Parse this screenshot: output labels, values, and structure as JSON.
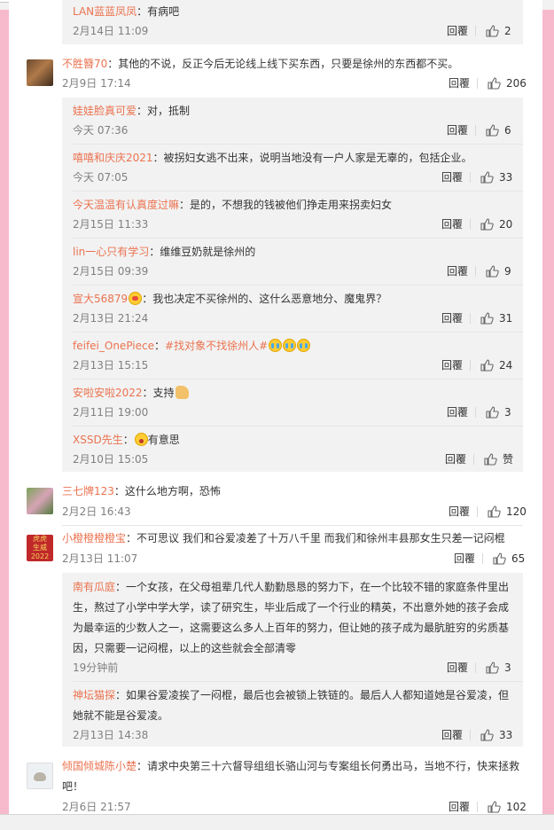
{
  "comments": [
    {
      "id": "c0",
      "user": "LAN蓝蓝凤凤",
      "text": "有病吧",
      "time": "2月14日 11:09",
      "reply": "回覆",
      "likes": "2"
    },
    {
      "id": "c1",
      "user": "不胜簪70",
      "text": "：其他的不说，反正今后无论线上线下买东西，只要是徐州的东西都不买。",
      "time": "2月9日 17:14",
      "reply": "回覆",
      "likes": "206"
    },
    {
      "id": "r1",
      "user": "娃娃脸真可爱",
      "text": "：对，抵制",
      "time": "今天 07:36",
      "reply": "回覆",
      "likes": "6"
    },
    {
      "id": "r2",
      "user": "嘻嘻和庆庆2021",
      "text": "：被拐妇女逃不出来，说明当地没有一户人家是无辜的，包括企业。",
      "time": "今天 07:05",
      "reply": "回覆",
      "likes": "33"
    },
    {
      "id": "r3",
      "user": "今天温温有认真度过嘛",
      "text": "：是的，不想我的钱被他们挣走用来拐卖妇女",
      "time": "2月15日 11:33",
      "reply": "回覆",
      "likes": "20"
    },
    {
      "id": "r4",
      "user": "lin一心只有学习",
      "text": "：维维豆奶就是徐州的",
      "time": "2月15日 09:39",
      "reply": "回覆",
      "likes": "9"
    },
    {
      "id": "r5",
      "user": "宣大56879",
      "text": "：我也决定不买徐州的、这什么恶意地分、魔鬼界？",
      "time": "2月13日 21:24",
      "reply": "回覆",
      "likes": "31"
    },
    {
      "id": "r6",
      "user": "feifei_OnePiece",
      "text": "：",
      "hashtag": "#找对象不找徐州人#",
      "time": "2月13日 15:15",
      "reply": "回覆",
      "likes": "24"
    },
    {
      "id": "r7",
      "user": "安啦安啦2022",
      "text": "：支持",
      "time": "2月11日 19:00",
      "reply": "回覆",
      "likes": "3"
    },
    {
      "id": "r8",
      "user": "XSSD先生",
      "text": "有意思",
      "time": "2月10日 15:05",
      "reply": "回覆",
      "likes": "赞"
    },
    {
      "id": "c2",
      "user": "三七牌123",
      "text": "：这什么地方啊，恐怖",
      "time": "2月2日 16:43",
      "reply": "回覆",
      "likes": "120"
    },
    {
      "id": "c3",
      "user": "小橙橙橙橙宝",
      "text": "：不可思议 我们和谷爱凌差了十万八千里 而我们和徐州丰县那女生只差一记闷棍",
      "time": "2月13日 11:07",
      "reply": "回覆",
      "likes": "65",
      "avatar_text": [
        "虎虎",
        "生威",
        "2022"
      ]
    },
    {
      "id": "r9",
      "user": "南有瓜庭",
      "lines": [
        "：一个女孩，在父母祖辈几代人勤勤恳恳的努力下，在一个比较不错的家庭条件里出",
        "生，熬过了小学中学大学，读了研究生，毕业后成了一个行业的精英，不出意外她的孩子会成",
        "为最幸运的少数人之一，这需要这么多人上百年的努力，但让她的孩子成为最肮脏穷的劣质基",
        "因，只需要一记闷棍，以上的这些就会全部清零"
      ],
      "time": "19分钟前",
      "reply": "回覆",
      "likes": "3"
    },
    {
      "id": "r10",
      "user": "神坛猫探",
      "lines": [
        "：如果谷爱凌挨了一闷棍，最后也会被锁上铁链的。最后人人都知道她是谷爱凌，但",
        "她就不能是谷爱凌。"
      ],
      "time": "2月13日 14:38",
      "reply": "回覆",
      "likes": "33"
    },
    {
      "id": "c4",
      "user": "倾国倾城陈小楚",
      "lines": [
        "：请求中央第三十六督导组组长骆山河与专案组长何勇出马，当地不行，快来拯救",
        "吧！"
      ],
      "time": "2月6日 21:57",
      "reply": "回覆",
      "likes": "102"
    }
  ],
  "colors": {
    "username": "#eb7350",
    "text": "#333333",
    "meta": "#808080",
    "sub_background": "#f2f2f2",
    "page_background": "#f7b9cc"
  },
  "icons": {
    "like": "thumbs-up-icon"
  }
}
